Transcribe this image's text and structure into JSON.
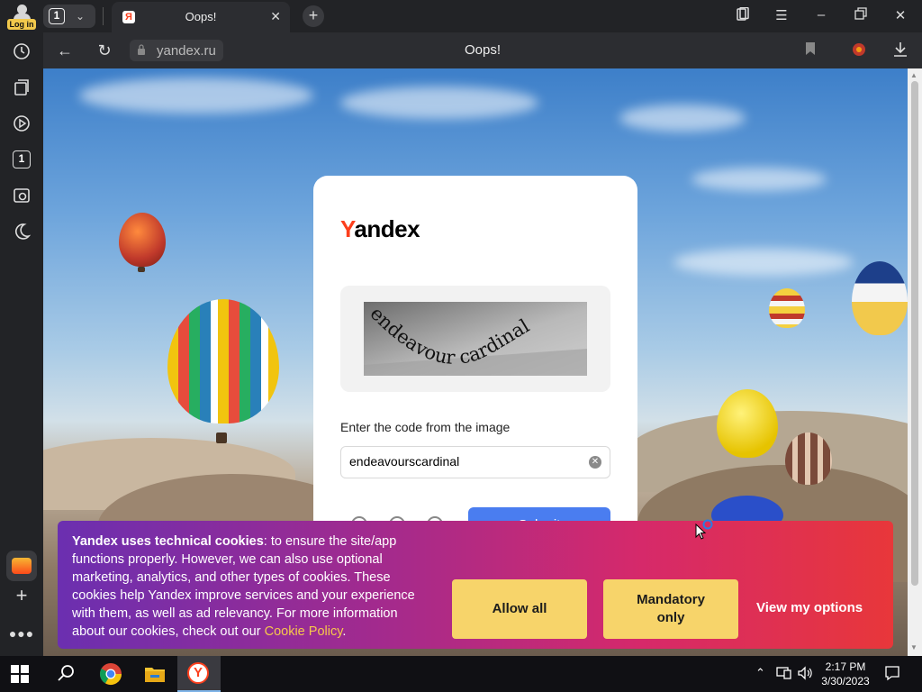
{
  "browser": {
    "login_label": "Log in",
    "tab_count": "1",
    "tab_title": "Oops!",
    "url": "yandex.ru",
    "page_title": "Oops!"
  },
  "sidebar": {
    "items": [
      "history-icon",
      "bookmarks-icon",
      "video-icon",
      "tabs-counter-icon",
      "screenshot-icon",
      "night-mode-icon",
      "mail-icon",
      "add-icon",
      "more-icon"
    ],
    "tabs_counter": "1"
  },
  "captcha": {
    "logo_y": "Y",
    "logo_rest": "andex",
    "captcha_text": "endeavour cardinal",
    "prompt": "Enter the code from the image",
    "input_value": "endeavourscardinal",
    "submit_label": "Submit"
  },
  "cookie_banner": {
    "bold": "Yandex uses technical cookies",
    "body": ": to ensure the site/app functions properly. However, we can also use optional marketing, analytics, and other types of cookies. These cookies help Yandex improve services and your experience with them, as well as ad relevancy. For more information about our cookies, check out our ",
    "policy_link": "Cookie Policy",
    "tail": ".",
    "allow_all": "Allow all",
    "mandatory_only": "Mandatory only",
    "view_options": "View my options"
  },
  "taskbar": {
    "time": "2:17 PM",
    "date": "3/30/2023"
  },
  "colors": {
    "yandex_red": "#fc3f1d",
    "submit_blue": "#4a7df0",
    "cookie_button": "#f7d46a",
    "policy_link": "#f7c84b"
  }
}
